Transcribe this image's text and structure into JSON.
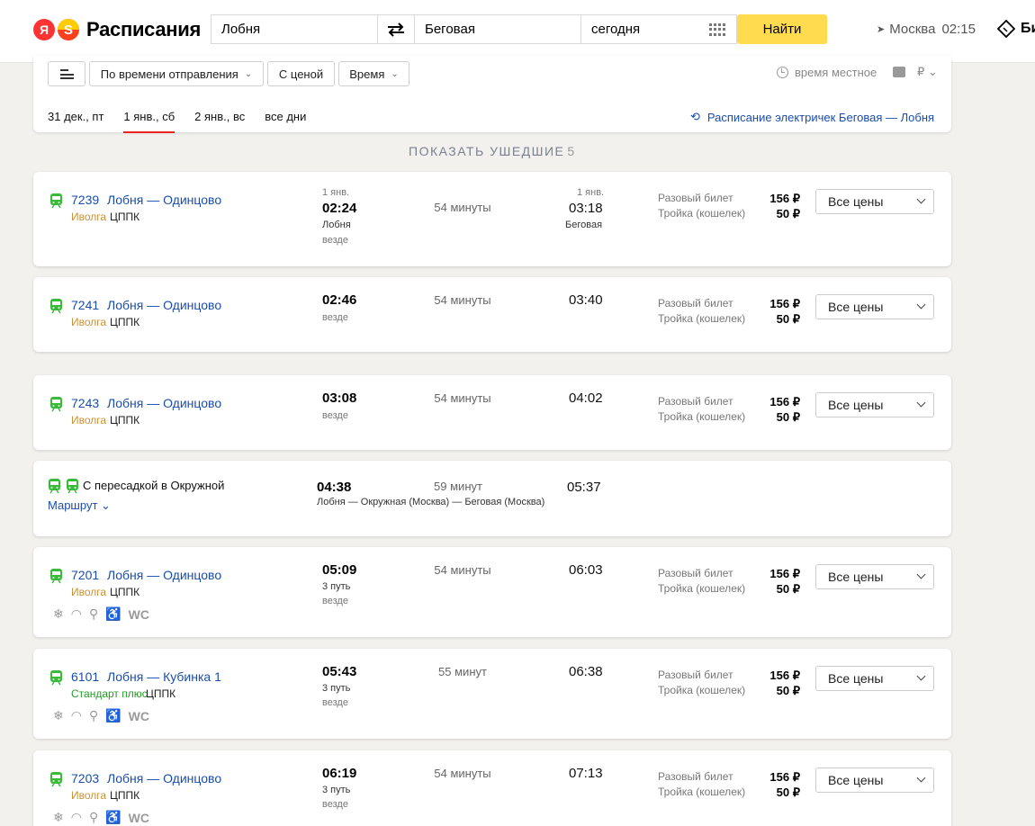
{
  "header": {
    "logo_mark": "Я",
    "logo_s": "S",
    "title": "Расписания",
    "from_value": "Лобня",
    "to_value": "Беговая",
    "date_value": "сегодня",
    "find_label": "Найти",
    "city": "Москва",
    "time": "02:15",
    "tickets_label": "Би"
  },
  "filters": {
    "sort_label": "По времени отправления",
    "with_price_label": "С ценой",
    "time_label": "Время",
    "local_time_label": "время местное",
    "currency": "₽",
    "days": [
      "31 дек., пт",
      "1 янв., сб",
      "2 янв., вс",
      "все дни"
    ],
    "active_day": "1 янв., сб",
    "elect_link": "Расписание электричек Беговая — Лобня"
  },
  "show_gone": {
    "label": "ПОКАЗАТЬ УШЕДШИЕ",
    "count": "5"
  },
  "tickets": {
    "single": "Разовый билет",
    "troika": "Тройка (кошелек)",
    "all_prices": "Все цены"
  },
  "trips": [
    {
      "number": "7239",
      "route": "Лобня — Одинцово",
      "brand": "Иволга",
      "carrier": "ЦППК",
      "dep_date": "1 янв.",
      "dep": "02:24",
      "dep_station": "Лобня",
      "dep_note": "везде",
      "duration": "54 минуты",
      "arr_date": "1 янв.",
      "arr": "03:18",
      "arr_station": "Беговая",
      "price_single": "156 ₽",
      "price_troika": "50 ₽"
    },
    {
      "number": "7241",
      "route": "Лобня — Одинцово",
      "brand": "Иволга",
      "carrier": "ЦППК",
      "dep": "02:46",
      "dep_note": "везде",
      "duration": "54 минуты",
      "arr": "03:40",
      "price_single": "156 ₽",
      "price_troika": "50 ₽"
    },
    {
      "number": "7243",
      "route": "Лобня — Одинцово",
      "brand": "Иволга",
      "carrier": "ЦППК",
      "dep": "03:08",
      "dep_note": "везде",
      "duration": "54 минуты",
      "arr": "04:02",
      "price_single": "156 ₽",
      "price_troika": "50 ₽"
    },
    {
      "transfer_title": "С пересадкой в Окружной",
      "route_link": "Маршрут",
      "dep": "04:38",
      "duration": "59 минут",
      "arr": "05:37",
      "via": "Лобня — Окружная (Москва) — Беговая (Москва)"
    },
    {
      "number": "7201",
      "route": "Лобня — Одинцово",
      "brand": "Иволга",
      "carrier": "ЦППК",
      "dep": "05:09",
      "dep_track": "3 путь",
      "dep_note": "везде",
      "duration": "54 минуты",
      "arr": "06:03",
      "price_single": "156 ₽",
      "price_troika": "50 ₽",
      "wc": "WC"
    },
    {
      "number": "6101",
      "route": "Лобня — Кубинка 1",
      "brand": "Стандарт плюс",
      "carrier": "ЦППК",
      "dep": "05:43",
      "dep_track": "3 путь",
      "dep_note": "везде",
      "duration": "55 минут",
      "arr": "06:38",
      "price_single": "156 ₽",
      "price_troika": "50 ₽",
      "wc": "WC"
    },
    {
      "number": "7203",
      "route": "Лобня — Одинцово",
      "brand": "Иволга",
      "carrier": "ЦППК",
      "dep": "06:19",
      "dep_track": "3 путь",
      "dep_note": "везде",
      "duration": "54 минуты",
      "arr": "07:13",
      "price_single": "156 ₽",
      "price_troika": "50 ₽",
      "wc": "WC"
    }
  ],
  "colors": {
    "accent_yellow": "#ffdb4d",
    "link_blue": "#1a4dad",
    "train_green": "#3ab93a",
    "brand_orange": "#c9913a",
    "active_red": "#ee2222"
  }
}
